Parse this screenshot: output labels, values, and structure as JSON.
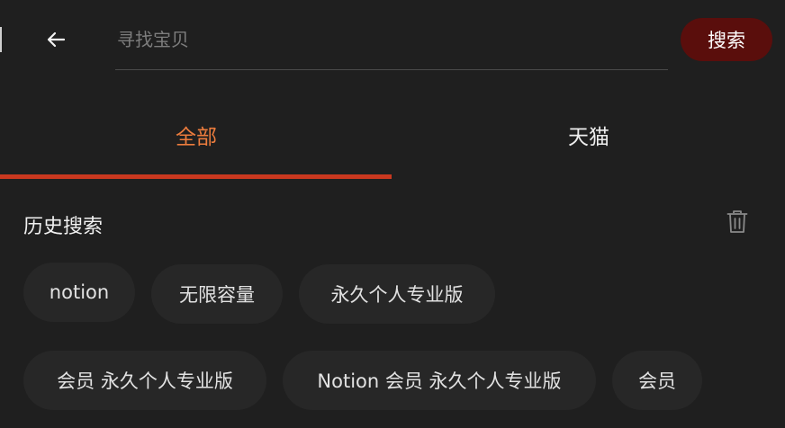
{
  "search": {
    "placeholder": "寻找宝贝",
    "value": "",
    "button_label": "搜索"
  },
  "tabs": [
    {
      "label": "全部",
      "active": true
    },
    {
      "label": "天猫",
      "active": false
    }
  ],
  "history": {
    "title": "历史搜索",
    "chips": [
      {
        "label": "notion"
      },
      {
        "label": "无限容量"
      },
      {
        "label": "永久个人专业版"
      },
      {
        "label": "会员 永久个人专业版"
      },
      {
        "label": "Notion 会员 永久个人专业版"
      },
      {
        "label": "会员"
      }
    ]
  },
  "colors": {
    "background": "#1f1f1f",
    "active_tab": "#ec7c3d",
    "indicator": "#c9381f",
    "search_button": "#5a0e0c",
    "chip_bg": "#272727"
  },
  "icons": {
    "back": "arrow-left-icon",
    "delete": "trash-icon"
  }
}
